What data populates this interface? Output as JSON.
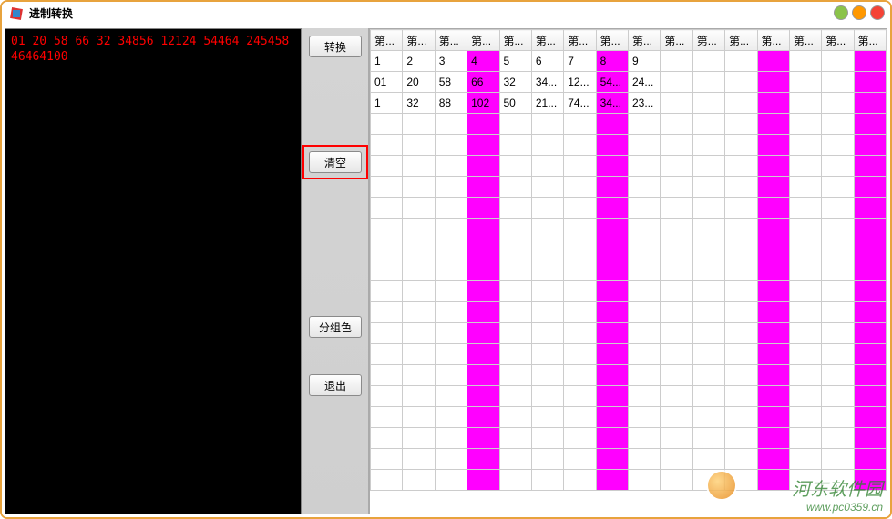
{
  "window": {
    "title": "进制转换"
  },
  "left_text": "01 20 58 66 32 34856 12124 54464 245458 46464100",
  "buttons": {
    "convert": "转换",
    "clear": "清空",
    "group_color": "分组色",
    "exit": "退出"
  },
  "table": {
    "header_prefix": "第...",
    "col_count": 16,
    "highlight_cols": [
      3,
      7,
      12,
      15
    ],
    "rows": [
      [
        "1",
        "2",
        "3",
        "4",
        "5",
        "6",
        "7",
        "8",
        "9",
        "",
        "",
        "",
        "",
        "",
        "",
        ""
      ],
      [
        "01",
        "20",
        "58",
        "66",
        "32",
        "34...",
        "12...",
        "54...",
        "24...",
        "",
        "",
        "",
        "",
        "",
        "",
        ""
      ],
      [
        "1",
        "32",
        "88",
        "102",
        "50",
        "21...",
        "74...",
        "34...",
        "23...",
        "",
        "",
        "",
        "",
        "",
        "",
        ""
      ]
    ],
    "empty_rows": 18
  },
  "watermark": {
    "text": "河东软件园",
    "url": "www.pc0359.cn"
  }
}
